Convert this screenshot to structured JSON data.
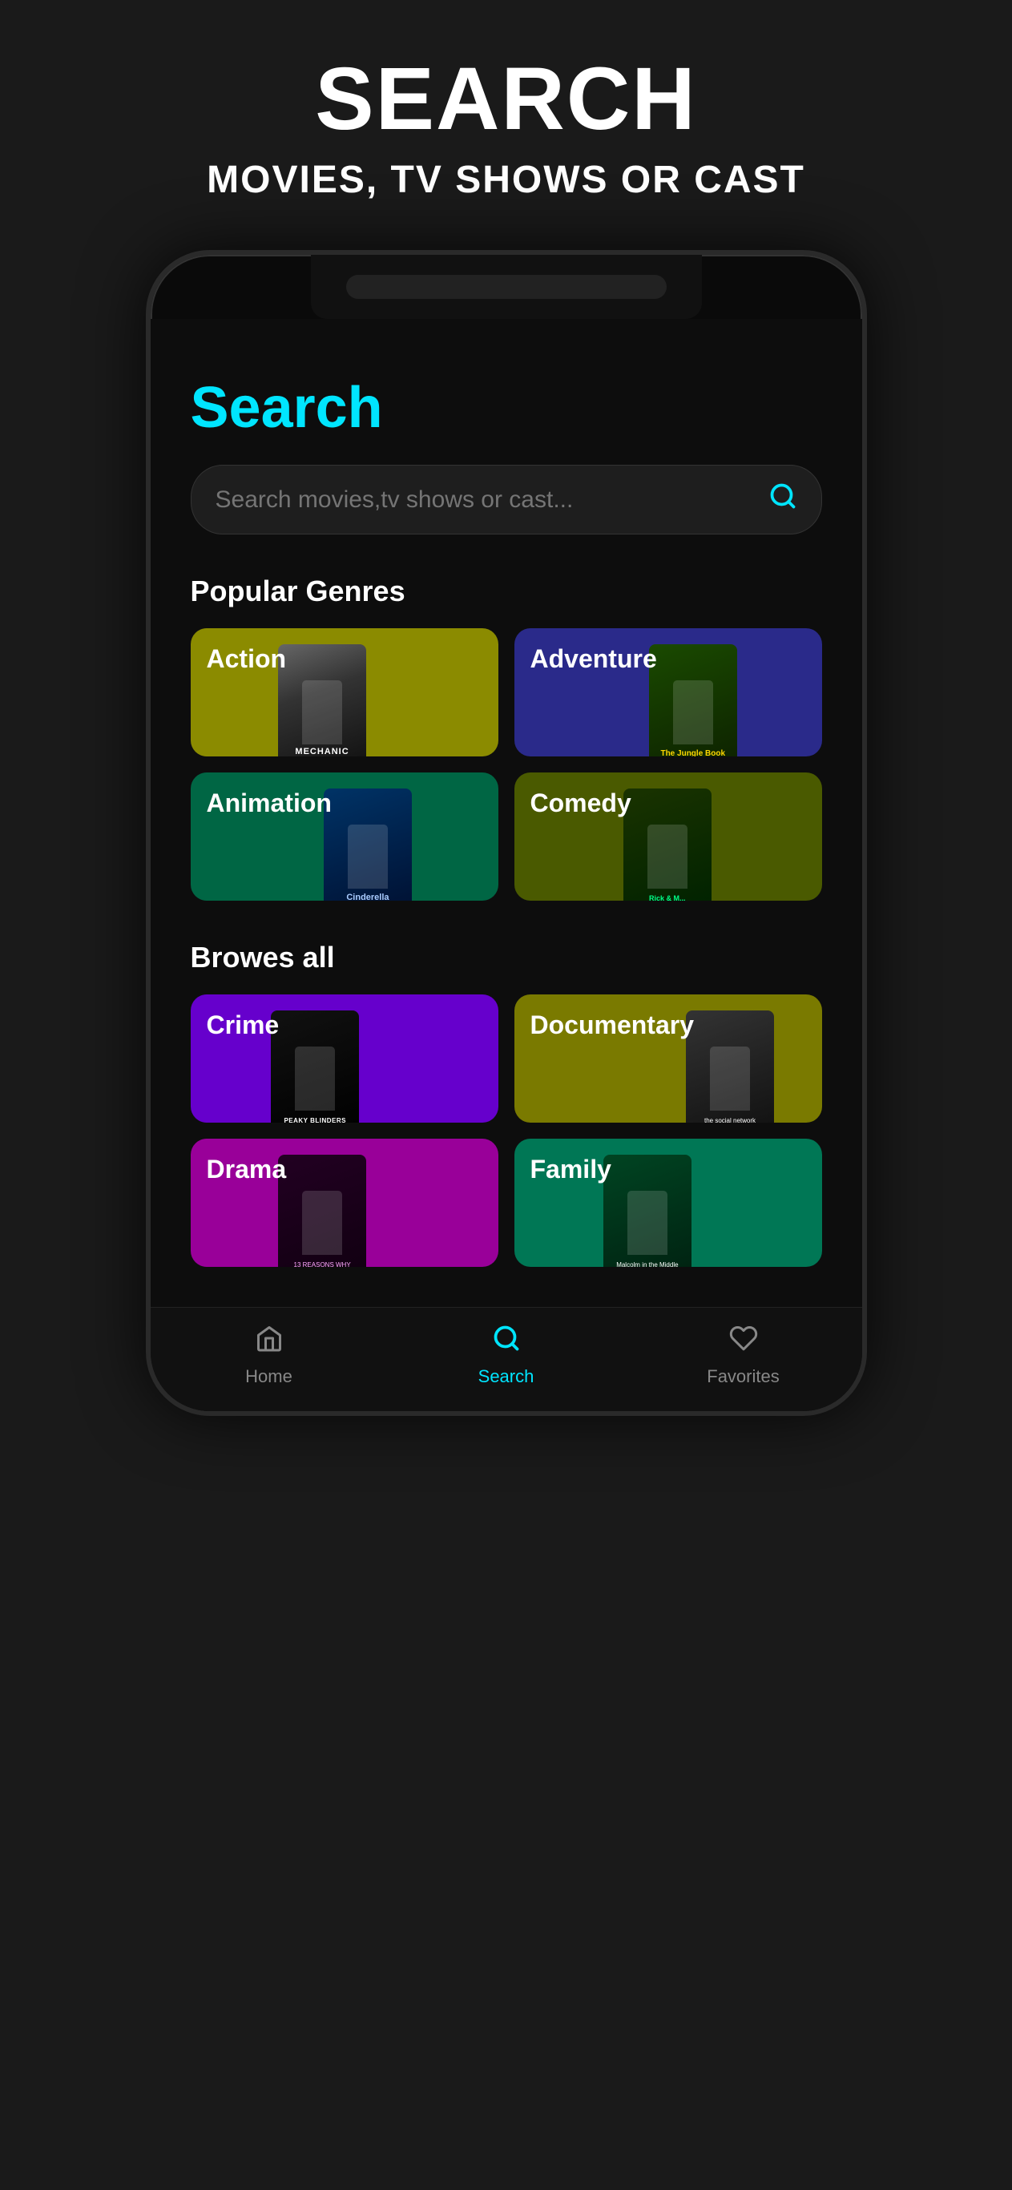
{
  "header": {
    "main_title": "SEARCH",
    "sub_title": "MOVIES, TV SHOWS OR CAST"
  },
  "screen": {
    "page_title": "Search",
    "search_bar": {
      "placeholder": "Search movies,tv shows or cast...",
      "icon": "search-icon"
    },
    "popular_genres_label": "Popular Genres",
    "genres": [
      {
        "id": "action",
        "label": "Action",
        "color": "#8B8B00",
        "poster_class": "poster-mechanic",
        "poster_text": "MECHANIC"
      },
      {
        "id": "adventure",
        "label": "Adventure",
        "color": "#2a2a8a",
        "poster_class": "poster-jungle",
        "poster_text": "The Jungle Book"
      },
      {
        "id": "animation",
        "label": "Animation",
        "color": "#006644",
        "poster_class": "poster-cinderella",
        "poster_text": "Cinderella"
      },
      {
        "id": "comedy",
        "label": "Comedy",
        "color": "#4a5a00",
        "poster_class": "poster-rick",
        "poster_text": "Rick & Morty"
      }
    ],
    "browse_all_label": "Browes all",
    "all_genres": [
      {
        "id": "crime",
        "label": "Crime",
        "color": "#6600cc",
        "poster_class": "poster-peaky",
        "poster_text": "Peaky Blinders"
      },
      {
        "id": "documentary",
        "label": "Documentary",
        "color": "#7a7a00",
        "poster_class": "poster-social",
        "poster_text": "The Social Network"
      },
      {
        "id": "drama",
        "label": "Drama",
        "color": "#990099",
        "poster_class": "poster-drama-show",
        "poster_text": "13 Reasons Why"
      },
      {
        "id": "family",
        "label": "Family",
        "color": "#007755",
        "poster_class": "poster-malcolm",
        "poster_text": "Malcolm in the Middle"
      }
    ]
  },
  "bottom_nav": {
    "items": [
      {
        "id": "home",
        "label": "Home",
        "icon": "🏠",
        "active": false
      },
      {
        "id": "search",
        "label": "Search",
        "icon": "🔍",
        "active": true
      },
      {
        "id": "favorites",
        "label": "Favorites",
        "icon": "🤍",
        "active": false
      }
    ]
  }
}
